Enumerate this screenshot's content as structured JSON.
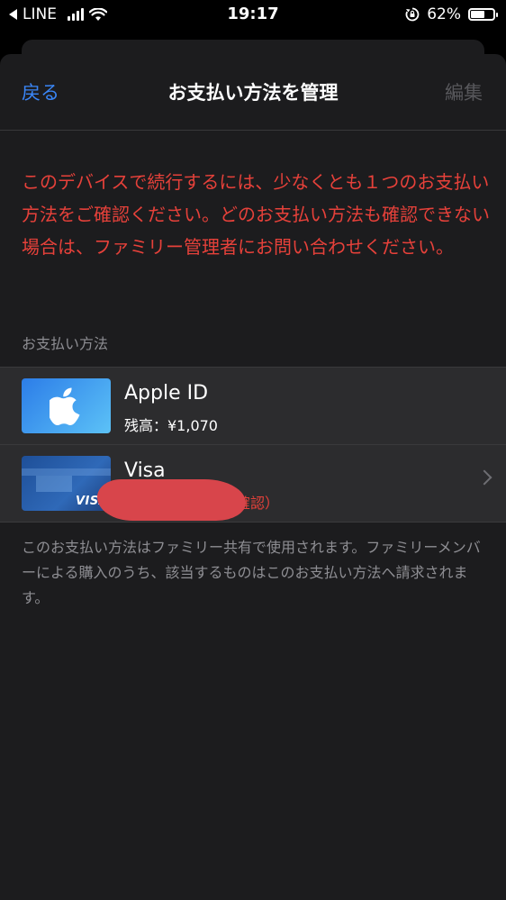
{
  "status_bar": {
    "carrier": "LINE",
    "time": "19:17",
    "battery_percent": "62%",
    "battery_level": 0.62
  },
  "nav": {
    "back_label": "戻る",
    "title": "お支払い方法を管理",
    "edit_label": "編集"
  },
  "warning_text": "このデバイスで続行するには、少なくとも１つのお支払い方法をご確認ください。どのお支払い方法も確認できない場合は、ファミリー管理者にお問い合わせください。",
  "section_header": "お支払い方法",
  "payment_methods": [
    {
      "title": "Apple ID",
      "subtitle": "残高：¥1,070",
      "icon": "apple-logo-icon"
    },
    {
      "title": "Visa",
      "subtitle": "（要確認）",
      "icon": "visa-card-icon"
    }
  ],
  "visa_logo_text": "VISA",
  "footer_note": "このお支払い方法はファミリー共有で使用されます。ファミリーメンバーによる購入のうち、該当するものはこのお支払い方法へ請求されます。",
  "colors": {
    "accent_blue": "#3a86f7",
    "warning_red": "#e6413a",
    "sheet_background": "#1c1c1e",
    "row_background": "#2c2c2e"
  }
}
